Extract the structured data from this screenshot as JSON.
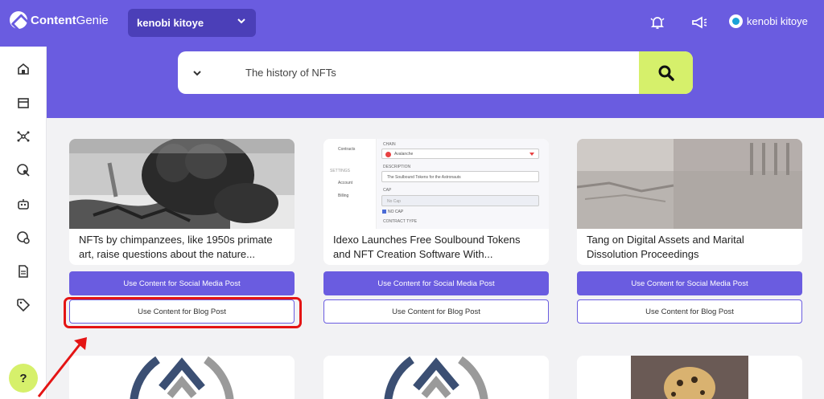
{
  "app": {
    "logo_bold": "Content",
    "logo_light": "Genie",
    "account_select": "kenobi kitoye",
    "user_name": "kenobi kitoye"
  },
  "icons": {
    "notifications": "bell-icon",
    "announcements": "megaphone-icon",
    "sidebar": [
      "home-icon",
      "store-icon",
      "network-icon",
      "search-globe-icon",
      "robot-icon",
      "globe-settings-icon",
      "document-icon",
      "tag-icon"
    ],
    "help": "?"
  },
  "search": {
    "value": "The history of NFTs"
  },
  "cards": [
    {
      "title_line1": "NFTs by chimpanzees, like 1950s primate",
      "title_line2": "art, raise questions about the nature...",
      "social_label": "Use Content for Social Media Post",
      "blog_label": "Use Content for Blog Post"
    },
    {
      "title_line1": "Idexo Launches Free Soulbound Tokens",
      "title_line2": "and NFT Creation Software With...",
      "social_label": "Use Content for Social Media Post",
      "blog_label": "Use Content for Blog Post"
    },
    {
      "title_line1": "Tang on Digital Assets and Marital",
      "title_line2": "Dissolution Proceedings",
      "social_label": "Use Content for Social Media Post",
      "blog_label": "Use Content for Blog Post"
    }
  ],
  "form_preview": {
    "nav_contracts": "Contracts",
    "nav_settings": "SETTINGS",
    "nav_account": "Account",
    "nav_billing": "Billing",
    "chain_label": "CHAIN",
    "chain_value": "Avalanche",
    "description_label": "DESCRIPTION",
    "description_value": "The Soulbound Tokens for the Astronauts",
    "cap_label": "CAP",
    "cap_value": "No Cap",
    "no_cap_check": "NO CAP",
    "contract_type_label": "CONTRACT TYPE"
  },
  "colors": {
    "brand": "#6a5ce0",
    "accent": "#d6f06b",
    "annotation": "#e41414"
  }
}
